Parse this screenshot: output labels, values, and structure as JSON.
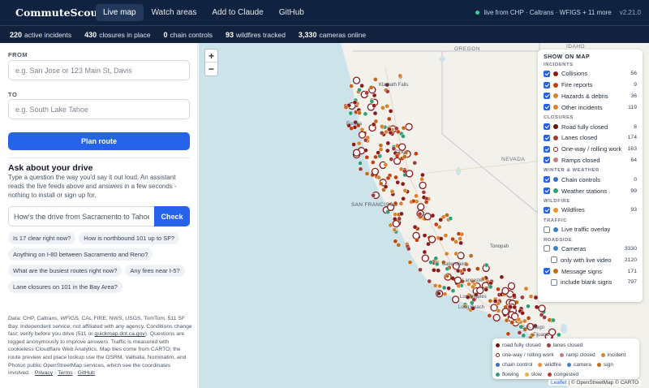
{
  "header": {
    "brand": "CommuteScout",
    "nav": [
      "Live map",
      "Watch areas",
      "Add to Claude",
      "GitHub"
    ],
    "live_status": "live from CHP · Caltrans · WFIGS + 11 more",
    "version": "v2.21.0"
  },
  "stats": [
    {
      "value": "220",
      "label": "active incidents"
    },
    {
      "value": "430",
      "label": "closures in place"
    },
    {
      "value": "0",
      "label": "chain controls"
    },
    {
      "value": "93",
      "label": "wildfires tracked"
    },
    {
      "value": "3,330",
      "label": "cameras online"
    }
  ],
  "route": {
    "from_label": "FROM",
    "from_placeholder": "e.g. San Jose or 123 Main St, Davis",
    "to_label": "TO",
    "to_placeholder": "e.g. South Lake Tahoe",
    "plan_button": "Plan route"
  },
  "ask": {
    "title": "Ask about your drive",
    "description": "Type a question the way you'd say it out loud. An assistant reads the live feeds above and answers in a few seconds - nothing to install or sign up for.",
    "placeholder": "How's the drive from Sacramento to Tahoe",
    "button": "Check",
    "suggestions": [
      "Is 17 clear right now?",
      "How is northbound 101 up to SF?",
      "Anything on I-80 between Sacramento and Reno?",
      "What are the busiest routes right now?",
      "Any fires near I-5?",
      "Lane closures on 101 in the Bay Area?"
    ]
  },
  "footer": {
    "text": "Data: CHP, Caltrans, WFIGS, CAL FIRE, NWS, USGS, TomTom, 511 SF Bay. Independent service, not affiliated with any agency. Conditions change fast; verify before you drive (511 or ",
    "link1": "quickmap.dot.ca.gov",
    "text2": "). Questions are logged anonymously to improve answers. Traffic is measured with cookieless Cloudflare Web Analytics. Map tiles come from CARTO; the route preview and place lookup use the OSRM, Valhalla, Nominatim, and Photon public OpenStreetMap services, which see the coordinates involved. · ",
    "privacy": "Privacy",
    "terms": "Terms",
    "github": "GitHub",
    "sep": " · "
  },
  "map": {
    "zoom_in": "+",
    "zoom_out": "−",
    "labels": {
      "idaho": "IDAHO",
      "oregon": "OREGON",
      "nevada": "NEVADA",
      "san_francisco": "SAN FRANCISCO",
      "klamath_falls": "Klamath Falls",
      "eureka": "Eureka",
      "chico": "Chico",
      "bakersfield": "Bakersfield",
      "los_angeles": "Los Angeles",
      "long_beach": "Long Beach",
      "san_diego": "San Diego",
      "tijuana": "Tijuana",
      "lancaster": "Lancaster",
      "tonopah": "Tonopah"
    },
    "colors": {
      "road_closed": "#8b1a1a",
      "lane_closed": "#a33b3b",
      "incident": "#d9822b",
      "fire": "#c2410c",
      "camera": "#3b82c4",
      "sign": "#c06a1a",
      "station": "#2f9e7a"
    }
  },
  "layers": {
    "title": "SHOW ON MAP",
    "groups": [
      {
        "heading": "INCIDENTS",
        "rows": [
          {
            "label": "Collisions",
            "count": "56",
            "checked": true,
            "color": "#8b1a1a"
          },
          {
            "label": "Fire reports",
            "count": "9",
            "checked": true,
            "color": "#c2410c"
          },
          {
            "label": "Hazards & debris",
            "count": "36",
            "checked": true,
            "color": "#d9822b"
          },
          {
            "label": "Other incidents",
            "count": "119",
            "checked": true,
            "color": "#d9822b"
          }
        ]
      },
      {
        "heading": "CLOSURES",
        "rows": [
          {
            "label": "Road fully closed",
            "count": "8",
            "checked": true,
            "color": "#6d1111"
          },
          {
            "label": "Lanes closed",
            "count": "174",
            "checked": true,
            "color": "#a33b3b"
          },
          {
            "label": "One-way / rolling work",
            "count": "163",
            "checked": true,
            "color": "#8b1a1a",
            "ring": true
          },
          {
            "label": "Ramps closed",
            "count": "64",
            "checked": true,
            "color": "#c08080"
          }
        ]
      },
      {
        "heading": "WINTER & WEATHER",
        "rows": [
          {
            "label": "Chain controls",
            "count": "0",
            "checked": true,
            "color": "#3b6fc4"
          },
          {
            "label": "Weather stations",
            "count": "99",
            "checked": true,
            "color": "#2f9e7a"
          }
        ]
      },
      {
        "heading": "WILDFIRE",
        "rows": [
          {
            "label": "Wildfires",
            "count": "93",
            "checked": true,
            "color": "#e8912d"
          }
        ]
      },
      {
        "heading": "TRAFFIC",
        "rows": [
          {
            "label": "Live traffic overlay",
            "count": "",
            "checked": false,
            "color": "#3b82c4"
          }
        ]
      },
      {
        "heading": "ROADSIDE",
        "rows": [
          {
            "label": "Cameras",
            "count": "3330",
            "checked": false,
            "color": "#3b82c4"
          },
          {
            "label": "only with live video",
            "count": "2120",
            "checked": false,
            "color": "",
            "sub": true
          },
          {
            "label": "Message signs",
            "count": "171",
            "checked": true,
            "color": "#c06a1a"
          },
          {
            "label": "include blank signs",
            "count": "797",
            "checked": false,
            "color": "",
            "sub": true
          }
        ]
      }
    ]
  },
  "legend": {
    "rows": [
      [
        {
          "label": "road fully closed",
          "color": "#6d1111"
        },
        {
          "label": "lanes closed",
          "color": "#a33b3b"
        }
      ],
      [
        {
          "label": "one-way / rolling work",
          "color": "#8b1a1a",
          "ring": true
        },
        {
          "label": "ramp closed",
          "color": "#c08080"
        },
        {
          "label": "incident",
          "color": "#d9822b"
        }
      ],
      [
        {
          "label": "chain control",
          "color": "#3b6fc4"
        },
        {
          "label": "wildfire",
          "color": "#e8912d"
        },
        {
          "label": "camera",
          "color": "#3b82c4"
        },
        {
          "label": "sign",
          "color": "#c06a1a"
        }
      ],
      [
        {
          "label": "flowing",
          "color": "#2f9e7a"
        },
        {
          "label": "slow",
          "color": "#e8b23d"
        },
        {
          "label": "congested",
          "color": "#c0392b"
        }
      ]
    ]
  },
  "attribution": {
    "leaflet": "Leaflet",
    "rest": "| © OpenStreetMap © CARTO"
  }
}
